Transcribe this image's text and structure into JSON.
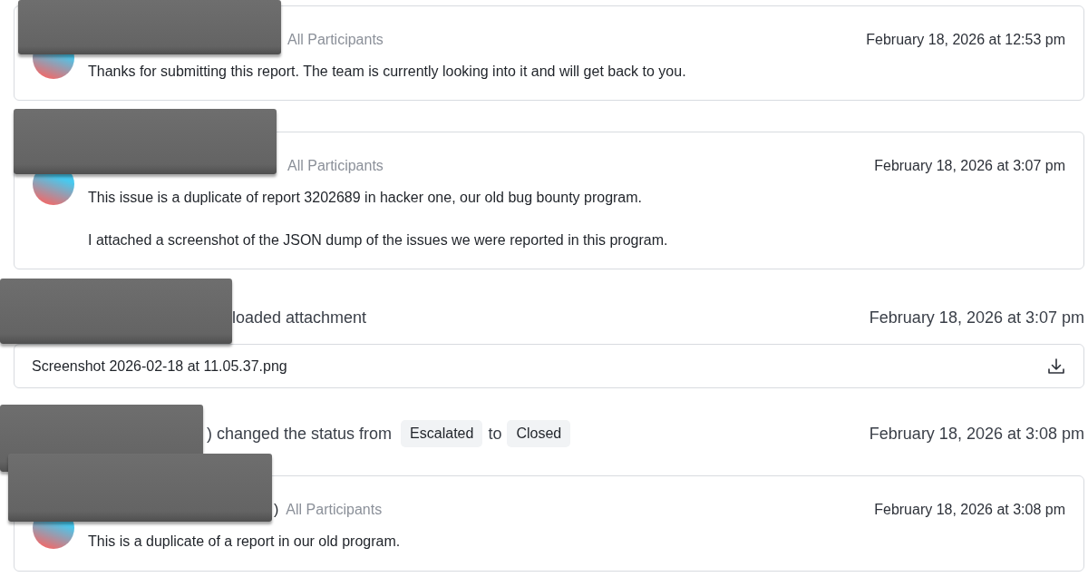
{
  "timeline": [
    {
      "kind": "comment",
      "visibility": "All Participants",
      "timestamp": "February 18, 2026 at 12:53 pm",
      "paragraphs": [
        "Thanks for submitting this report. The team is currently looking into it and will get back to you."
      ]
    },
    {
      "kind": "comment",
      "visibility": "All Participants",
      "timestamp": "February 18, 2026 at 3:07 pm",
      "paragraphs": [
        "This issue is a duplicate of report 3202689 in hacker one, our old bug bounty program.",
        "I attached a screenshot of the JSON dump of the issues we were reported in this program."
      ]
    },
    {
      "kind": "attachment",
      "action": "loaded attachment",
      "timestamp": "February 18, 2026 at 3:07 pm",
      "file": {
        "name": "Screenshot 2026-02-18 at 11.05.37.png"
      }
    },
    {
      "kind": "status_change",
      "action": ") changed the status from",
      "from": "Escalated",
      "joiner": "to",
      "to": "Closed",
      "timestamp": "February 18, 2026 at 3:08 pm"
    },
    {
      "kind": "comment",
      "author_tail": ")",
      "visibility": "All Participants",
      "timestamp": "February 18, 2026 at 3:08 pm",
      "paragraphs": [
        "This is a duplicate of a report in our old program."
      ]
    }
  ]
}
